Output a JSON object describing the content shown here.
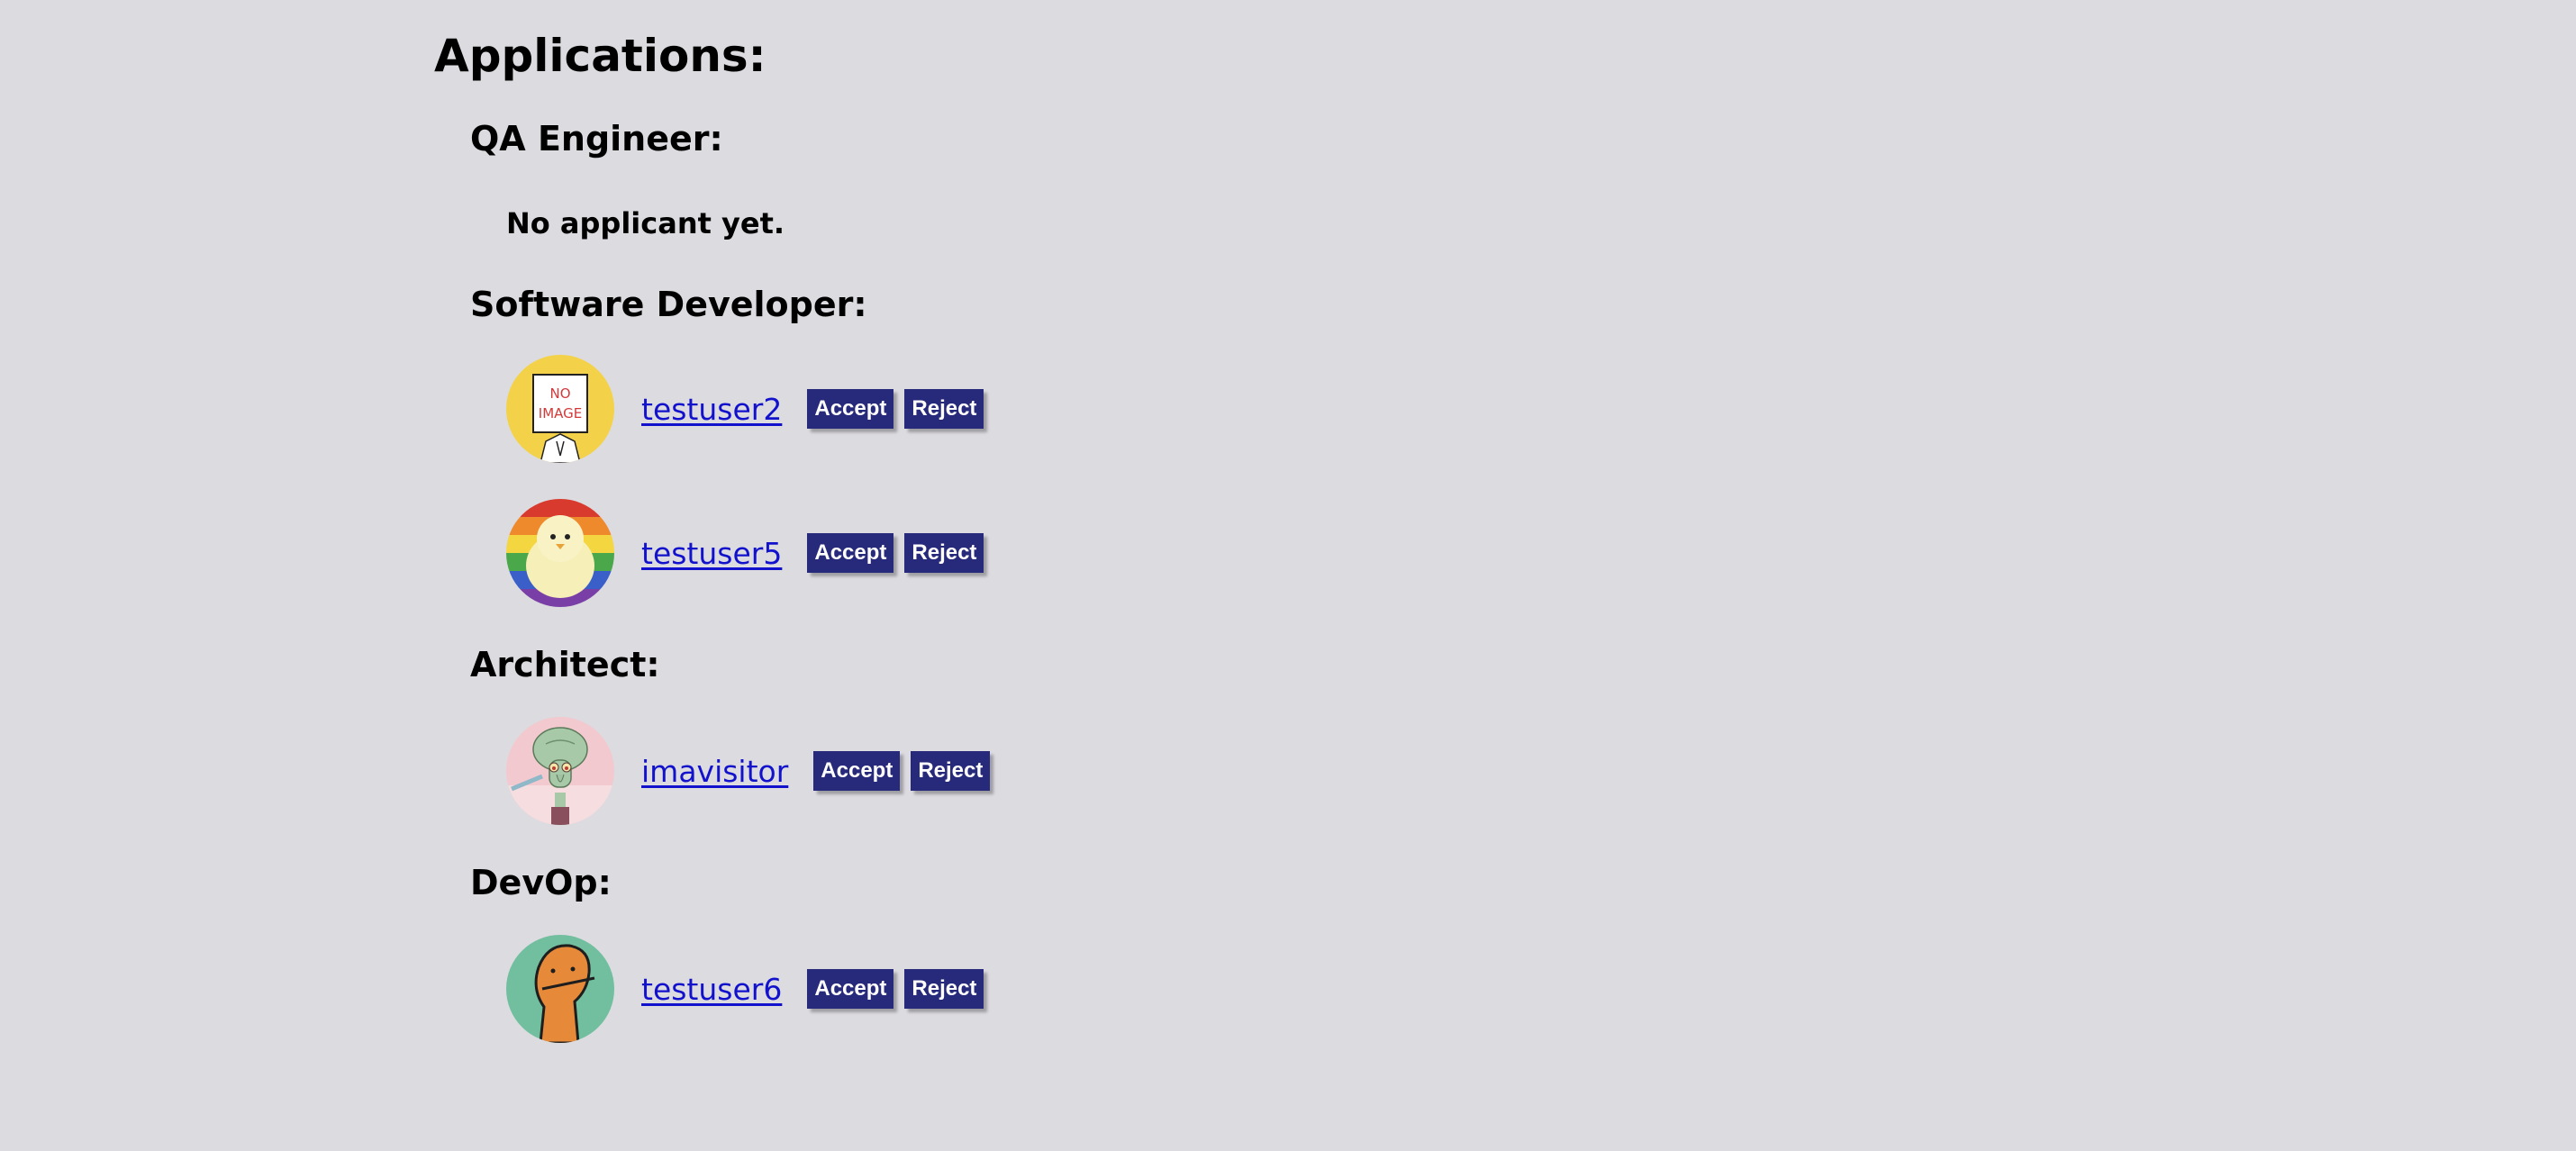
{
  "page": {
    "title": "Applications:"
  },
  "jobs": [
    {
      "title": "QA Engineer:",
      "empty_text": "No applicant yet.",
      "applicants": []
    },
    {
      "title": "Software Developer:",
      "applicants": [
        {
          "username": "testuser2",
          "avatar": "no-image-placeholder",
          "accept": "Accept",
          "reject": "Reject"
        },
        {
          "username": "testuser5",
          "avatar": "chick-rainbow",
          "accept": "Accept",
          "reject": "Reject"
        }
      ]
    },
    {
      "title": "Architect:",
      "applicants": [
        {
          "username": "imavisitor",
          "avatar": "squidward",
          "accept": "Accept",
          "reject": "Reject"
        }
      ]
    },
    {
      "title": "DevOp:",
      "applicants": [
        {
          "username": "testuser6",
          "avatar": "orange-creature",
          "accept": "Accept",
          "reject": "Reject"
        }
      ]
    }
  ],
  "avatar_placeholder_text": [
    "NO",
    "IMAGE"
  ],
  "colors": {
    "background": "#dcdbe0",
    "button": "#27297a",
    "link": "#1212cc"
  }
}
